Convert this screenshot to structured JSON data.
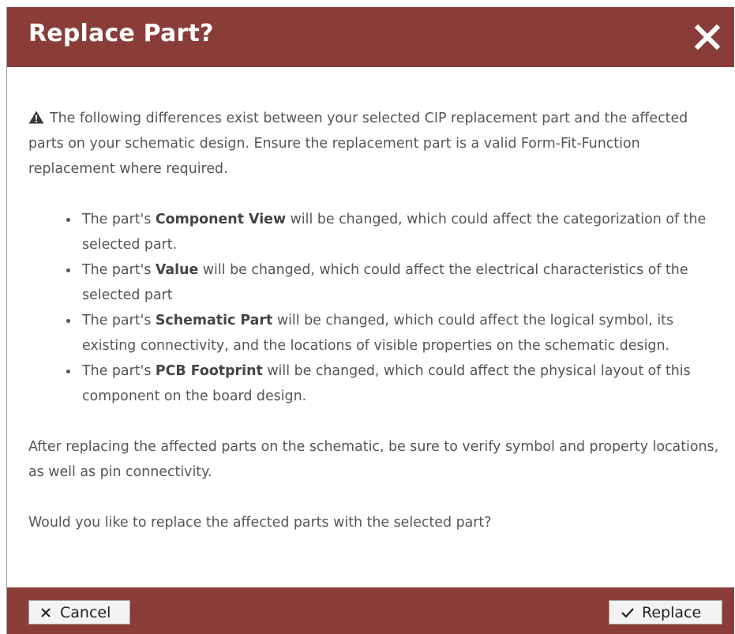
{
  "dialog": {
    "title": "Replace Part?",
    "close_icon": "close-icon",
    "colors": {
      "header": "#8a3d38",
      "text": "#555555"
    }
  },
  "content": {
    "warning_icon": "warning-icon",
    "warning_text": "The following differences exist between your selected CIP replacement part and the affected parts on your schematic design. Ensure the replacement part is a valid Form-Fit-Function replacement where required.",
    "items": [
      {
        "prefix": "The part's ",
        "field": "Component View",
        "suffix": " will be changed, which could affect the categorization of the selected part."
      },
      {
        "prefix": "The part's ",
        "field": "Value",
        "suffix": " will be changed, which could affect the electrical characteristics of the selected part"
      },
      {
        "prefix": "The part's ",
        "field": "Schematic Part",
        "suffix": " will be changed, which could affect the logical symbol, its existing connectivity, and the locations of visible properties on the schematic design."
      },
      {
        "prefix": "The part's ",
        "field": "PCB Footprint",
        "suffix": " will be changed, which could affect the physical layout of this component on the board design."
      }
    ],
    "after_text": "After replacing the affected parts on the schematic, be sure to verify symbol and property locations, as well as pin connectivity.",
    "question": "Would you like to replace the affected parts with the selected part?"
  },
  "footer": {
    "cancel_label": "Cancel",
    "cancel_icon": "x-icon",
    "replace_label": "Replace",
    "replace_icon": "checkmark-icon"
  }
}
